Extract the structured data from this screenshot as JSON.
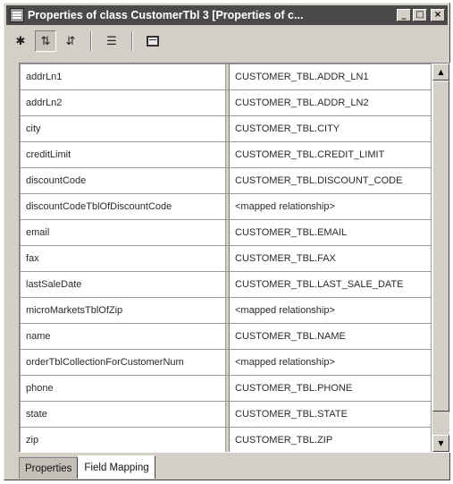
{
  "window": {
    "title": "Properties of class CustomerTbl 3 [Properties of c...",
    "min_glyph": "_",
    "max_glyph": "□",
    "close_glyph": "×"
  },
  "toolbar": {
    "icons": [
      "pin-icon",
      "sort-ascending-icon",
      "sort-category-icon",
      "filter-list-icon",
      "frame-icon"
    ]
  },
  "table": {
    "rows": [
      {
        "name": "addrLn1",
        "value": "CUSTOMER_TBL.ADDR_LN1"
      },
      {
        "name": "addrLn2",
        "value": "CUSTOMER_TBL.ADDR_LN2"
      },
      {
        "name": "city",
        "value": "CUSTOMER_TBL.CITY"
      },
      {
        "name": "creditLimit",
        "value": "CUSTOMER_TBL.CREDIT_LIMIT"
      },
      {
        "name": "discountCode",
        "value": "CUSTOMER_TBL.DISCOUNT_CODE"
      },
      {
        "name": "discountCodeTblOfDiscountCode",
        "value": "<mapped relationship>"
      },
      {
        "name": "email",
        "value": "CUSTOMER_TBL.EMAIL"
      },
      {
        "name": "fax",
        "value": "CUSTOMER_TBL.FAX"
      },
      {
        "name": "lastSaleDate",
        "value": "CUSTOMER_TBL.LAST_SALE_DATE"
      },
      {
        "name": "microMarketsTblOfZip",
        "value": "<mapped relationship>"
      },
      {
        "name": "name",
        "value": "CUSTOMER_TBL.NAME"
      },
      {
        "name": "orderTblCollectionForCustomerNum",
        "value": "<mapped relationship>"
      },
      {
        "name": "phone",
        "value": "CUSTOMER_TBL.PHONE"
      },
      {
        "name": "state",
        "value": "CUSTOMER_TBL.STATE"
      },
      {
        "name": "zip",
        "value": "CUSTOMER_TBL.ZIP"
      }
    ]
  },
  "tabs": [
    {
      "label": "Properties",
      "active": false
    },
    {
      "label": "Field Mapping",
      "active": true
    }
  ]
}
